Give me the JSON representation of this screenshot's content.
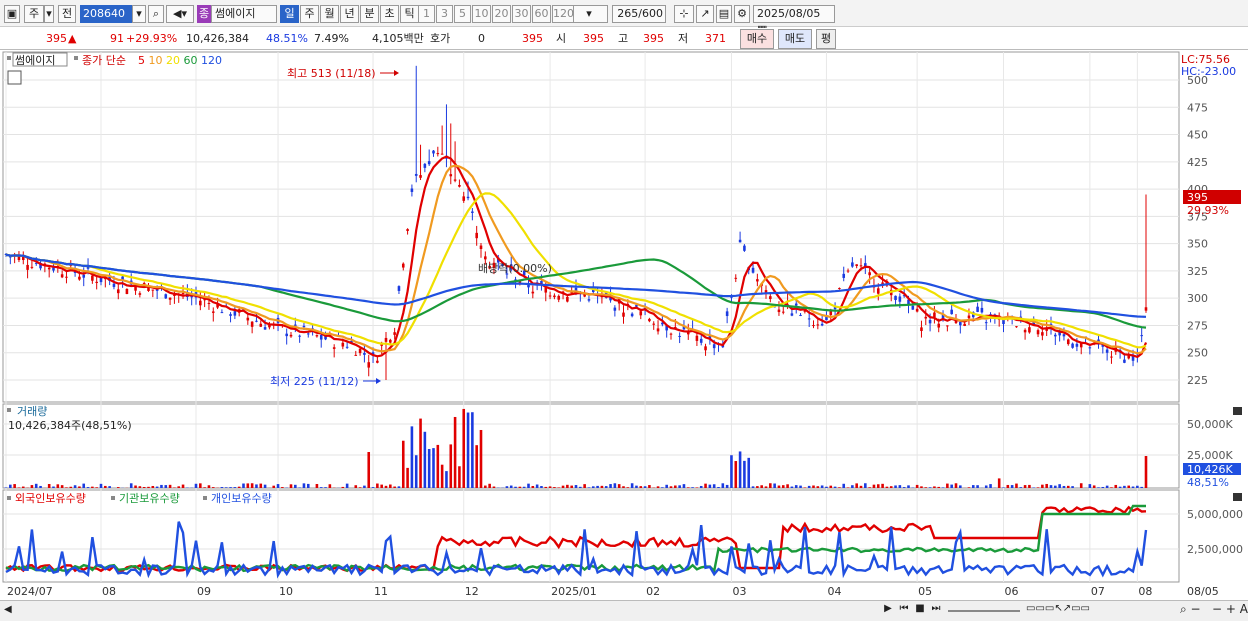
{
  "toolbar": {
    "market": "주",
    "prev": "전",
    "code": "208640",
    "stock_name": "썸에이지",
    "stock_tag": "종",
    "periods": [
      "일",
      "주",
      "월",
      "년",
      "분",
      "초",
      "틱"
    ],
    "active_period": "일",
    "intervals": [
      "1",
      "3",
      "5",
      "10",
      "20",
      "30",
      "60",
      "120"
    ],
    "count": "265",
    "count_total": "/600",
    "date": "2025/08/05"
  },
  "quote": {
    "price": "395",
    "change": "91",
    "change_pct": "+29.93%",
    "volume": "10,426,384",
    "vol_ratio": "48.51%",
    "turnover": "7.49%",
    "amount": "4,105백만",
    "hoga_label": "호가",
    "hoga_val": "0",
    "hoga_price": "395",
    "open_label": "시",
    "open": "395",
    "high_label": "고",
    "high": "395",
    "low_label": "저",
    "low": "371",
    "buy": "매수",
    "sell": "매도",
    "eval": "평"
  },
  "price_panel": {
    "legend_name": "썸에이지",
    "legend_ma": "종가 단순",
    "ma_periods": [
      "5",
      "10",
      "20",
      "60",
      "120"
    ],
    "ma_colors": [
      "#e00000",
      "#f09a20",
      "#f0e000",
      "#1a9a3a",
      "#2050e0"
    ],
    "lc": "LC:75.56",
    "hc": "HC:-23.00",
    "y_ticks": [
      "500",
      "475",
      "450",
      "425",
      "400",
      "375",
      "350",
      "325",
      "300",
      "275",
      "250",
      "225"
    ],
    "last_price": "395",
    "last_pct": "29.93%",
    "high_note": "최고 513 (11/18)",
    "low_note": "최저 225 (11/12)",
    "div_note": "배당락(0.00%)"
  },
  "volume_panel": {
    "title": "거래량",
    "value": "10,426,384주(48,51%)",
    "y_ticks": [
      "50,000K",
      "25,000K"
    ],
    "last": "10,426K",
    "last_pct": "48,51%"
  },
  "holding_panel": {
    "labels": [
      "외국인보유수량",
      "기관보유수량",
      "개인보유수량"
    ],
    "colors": [
      "#e00000",
      "#1a9a3a",
      "#2050e0"
    ],
    "y_ticks": [
      "5,000,000",
      "2,500,000"
    ]
  },
  "x_axis": [
    "2024/07",
    "08",
    "09",
    "10",
    "11",
    "12",
    "2025/01",
    "02",
    "03",
    "04",
    "05",
    "06",
    "07",
    "08",
    "08/05"
  ]
}
